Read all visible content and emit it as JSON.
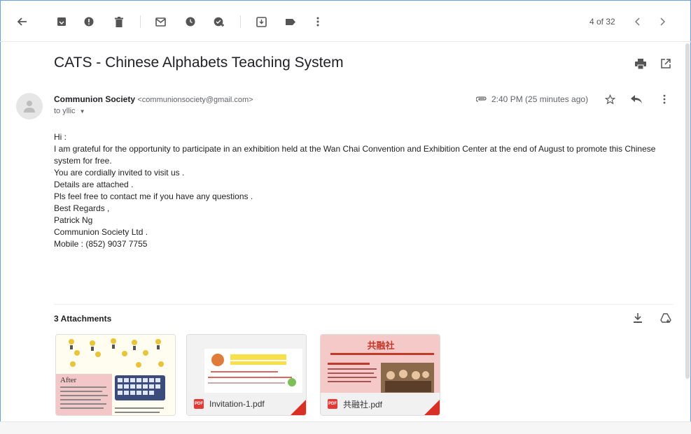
{
  "toolbar": {
    "pager": "4 of 32"
  },
  "email": {
    "subject": "CATS - Chinese Alphabets Teaching System",
    "sender_name": "Communion Society",
    "sender_email": "<communionsociety@gmail.com>",
    "to": "to yllic",
    "time": "2:40 PM (25 minutes ago)",
    "body": [
      "Hi :",
      "I am grateful for the opportunity to participate in an exhibition held at the Wan Chai Convention and Exhibition Center at the end of August to promote this Chinese system for free.",
      "You are cordially invited to visit us .",
      "Details are attached .",
      "Pls feel free to contact me if you have any questions .",
      "Best Regards ,",
      "Patrick Ng",
      "Communion Society Ltd .",
      "Mobile : (852) 9037 7755"
    ]
  },
  "attachments": {
    "title": "3 Attachments",
    "items": [
      {
        "name": "",
        "thumb_text": "After"
      },
      {
        "name": "Invitation-1.pdf",
        "badge": "PDF"
      },
      {
        "name": "共融社.pdf",
        "badge": "PDF",
        "thumb_title": "共融社"
      }
    ]
  },
  "colors": {
    "accent_red": "#d93025",
    "frame_blue": "#6a9fd8"
  },
  "icons": [
    "back-arrow-icon",
    "archive-icon",
    "report-spam-icon",
    "delete-icon",
    "mark-unread-icon",
    "snooze-icon",
    "add-task-icon",
    "move-to-icon",
    "label-icon",
    "more-vert-icon",
    "prev-icon",
    "next-icon",
    "print-icon",
    "open-new-window-icon",
    "attachment-clip-icon",
    "star-icon",
    "reply-icon",
    "more-vert-icon",
    "download-all-icon",
    "save-to-drive-icon"
  ]
}
